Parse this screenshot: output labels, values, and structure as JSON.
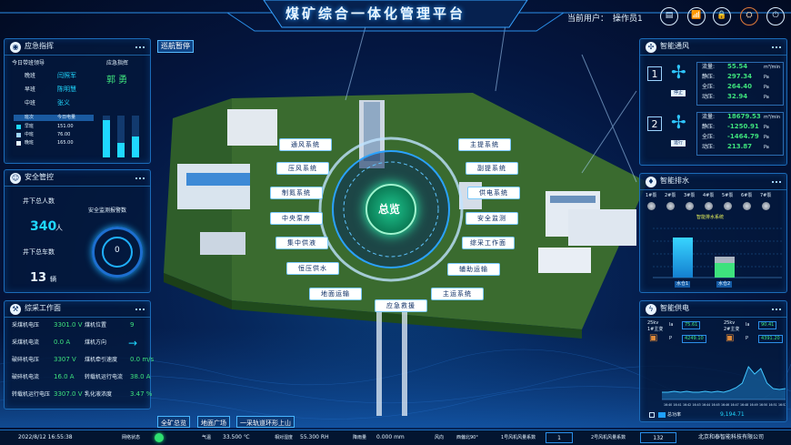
{
  "header": {
    "title": "煤矿综合一体化管理平台",
    "current_user_label": "当前用户：",
    "current_user": "操作员1"
  },
  "top_icons": [
    "document-icon",
    "chart-icon",
    "lock-icon",
    "emblem-icon",
    "power-icon"
  ],
  "cruise_pause": "巡航暂停",
  "emergency": {
    "title": "应急指挥",
    "today_label": "今日带班领导",
    "dispatch_label": "应急指挥",
    "shifts": [
      {
        "label": "晚班",
        "name": "闫照军"
      },
      {
        "label": "早班",
        "name": "陈明慧"
      },
      {
        "label": "中班",
        "name": "张义"
      }
    ],
    "commander": "郭 勇",
    "table_header": [
      "班次",
      "今日电量"
    ],
    "table_rows": [
      {
        "shift": "早班",
        "value": "151.00"
      },
      {
        "shift": "中班",
        "value": "76.00"
      },
      {
        "shift": "晚班",
        "value": "165.00"
      }
    ],
    "bars": [
      0.9,
      0.35,
      0.5
    ]
  },
  "safety": {
    "title": "安全管控",
    "people_label": "井下总人数",
    "people_value": "340",
    "people_unit": "人",
    "alarm_label": "安全监测报警数",
    "alarm_value": "0",
    "cars_label": "井下总车数",
    "cars_value": "13",
    "cars_unit": "辆"
  },
  "mining": {
    "title": "综采工作面",
    "rows": [
      {
        "l1": "采煤机电压",
        "v1": "3301.0 V",
        "l2": "煤机位置",
        "v2": "9"
      },
      {
        "l1": "采煤机电流",
        "v1": "0.0 A",
        "l2": "煤机方向",
        "v2": "→"
      },
      {
        "l1": "破碎机电压",
        "v1": "3307 V",
        "l2": "煤机牵引速度",
        "v2": "0.0 m/s"
      },
      {
        "l1": "破碎机电流",
        "v1": "16.0 A",
        "l2": "转载机运行电流",
        "v2": "38.0 A"
      },
      {
        "l1": "转载机运行电压",
        "v1": "3307.0 V",
        "l2": "乳化液浓度",
        "v2": "3.47 %"
      }
    ]
  },
  "ventilation": {
    "title": "智能通风",
    "fans": [
      {
        "index": "1",
        "state": "停止",
        "rows": [
          {
            "l": "流量:",
            "v": "55.54",
            "u": "m³/min"
          },
          {
            "l": "静压:",
            "v": "297.34",
            "u": "Pa"
          },
          {
            "l": "全压:",
            "v": "264.40",
            "u": "Pa"
          },
          {
            "l": "动压:",
            "v": "32.94",
            "u": "Pa"
          }
        ]
      },
      {
        "index": "2",
        "state": "运行",
        "rows": [
          {
            "l": "流量:",
            "v": "18679.53",
            "u": "m³/min"
          },
          {
            "l": "静压:",
            "v": "-1250.91",
            "u": "Pa"
          },
          {
            "l": "全压:",
            "v": "-1464.79",
            "u": "Pa"
          },
          {
            "l": "动压:",
            "v": "213.87",
            "u": "Pa"
          }
        ]
      }
    ]
  },
  "drainage": {
    "title": "智能排水",
    "pumps": [
      "1#泵",
      "2#泵",
      "3#泵",
      "4#泵",
      "5#泵",
      "6#泵",
      "7#泵"
    ],
    "legend": "智能排水系统",
    "tanks": [
      "水仓1",
      "水仓2"
    ],
    "tank_levels": [
      0.85,
      0.45
    ]
  },
  "power": {
    "title": "智能供电",
    "units": [
      {
        "kv": "25kv",
        "sub": "1#主变",
        "ia": "la",
        "ia_v": "75.61",
        "p": "P",
        "p_v": "4249.10"
      },
      {
        "kv": "25kv",
        "sub": "2#主变",
        "ia": "la",
        "ia_v": "90.41",
        "p": "P",
        "p_v": "4391.20"
      }
    ],
    "total_label": "总功率",
    "total_value": "9,194.71",
    "x_ticks": [
      "16:40",
      "16:41",
      "16:42",
      "16:43",
      "16:44",
      "16:45",
      "16:46",
      "16:47",
      "16:48",
      "16:49",
      "16:50",
      "16:51",
      "16:52"
    ]
  },
  "hub": {
    "center": "总览",
    "systems": [
      "通风系统",
      "压风系统",
      "制氮系统",
      "中央泵房",
      "集中供液",
      "恒压供水",
      "地面运输",
      "应急救援",
      "主运系统",
      "辅助运输",
      "综采工作面",
      "安全监测",
      "供电系统",
      "副提系统",
      "主提系统"
    ]
  },
  "bottom_nav": [
    "全矿总览",
    "地面广场",
    "一采轨道环形上山"
  ],
  "status": {
    "datetime": "2022/8/12 16:55:38",
    "net_label": "网络状态",
    "temp_label": "气温",
    "temp": "33.500 ℃",
    "humid_label": "相对湿度",
    "humid": "55.300 RH",
    "rain_label": "降雨量",
    "rain": "0.000 mm",
    "wind_label": "风向",
    "wind": "西偏北90°",
    "fan1_label": "1号风机风量系数",
    "fan1": "1",
    "fan2_label": "2号风机风量系数",
    "fan2": "132",
    "company": "北京和泰智能科技有限公司"
  }
}
